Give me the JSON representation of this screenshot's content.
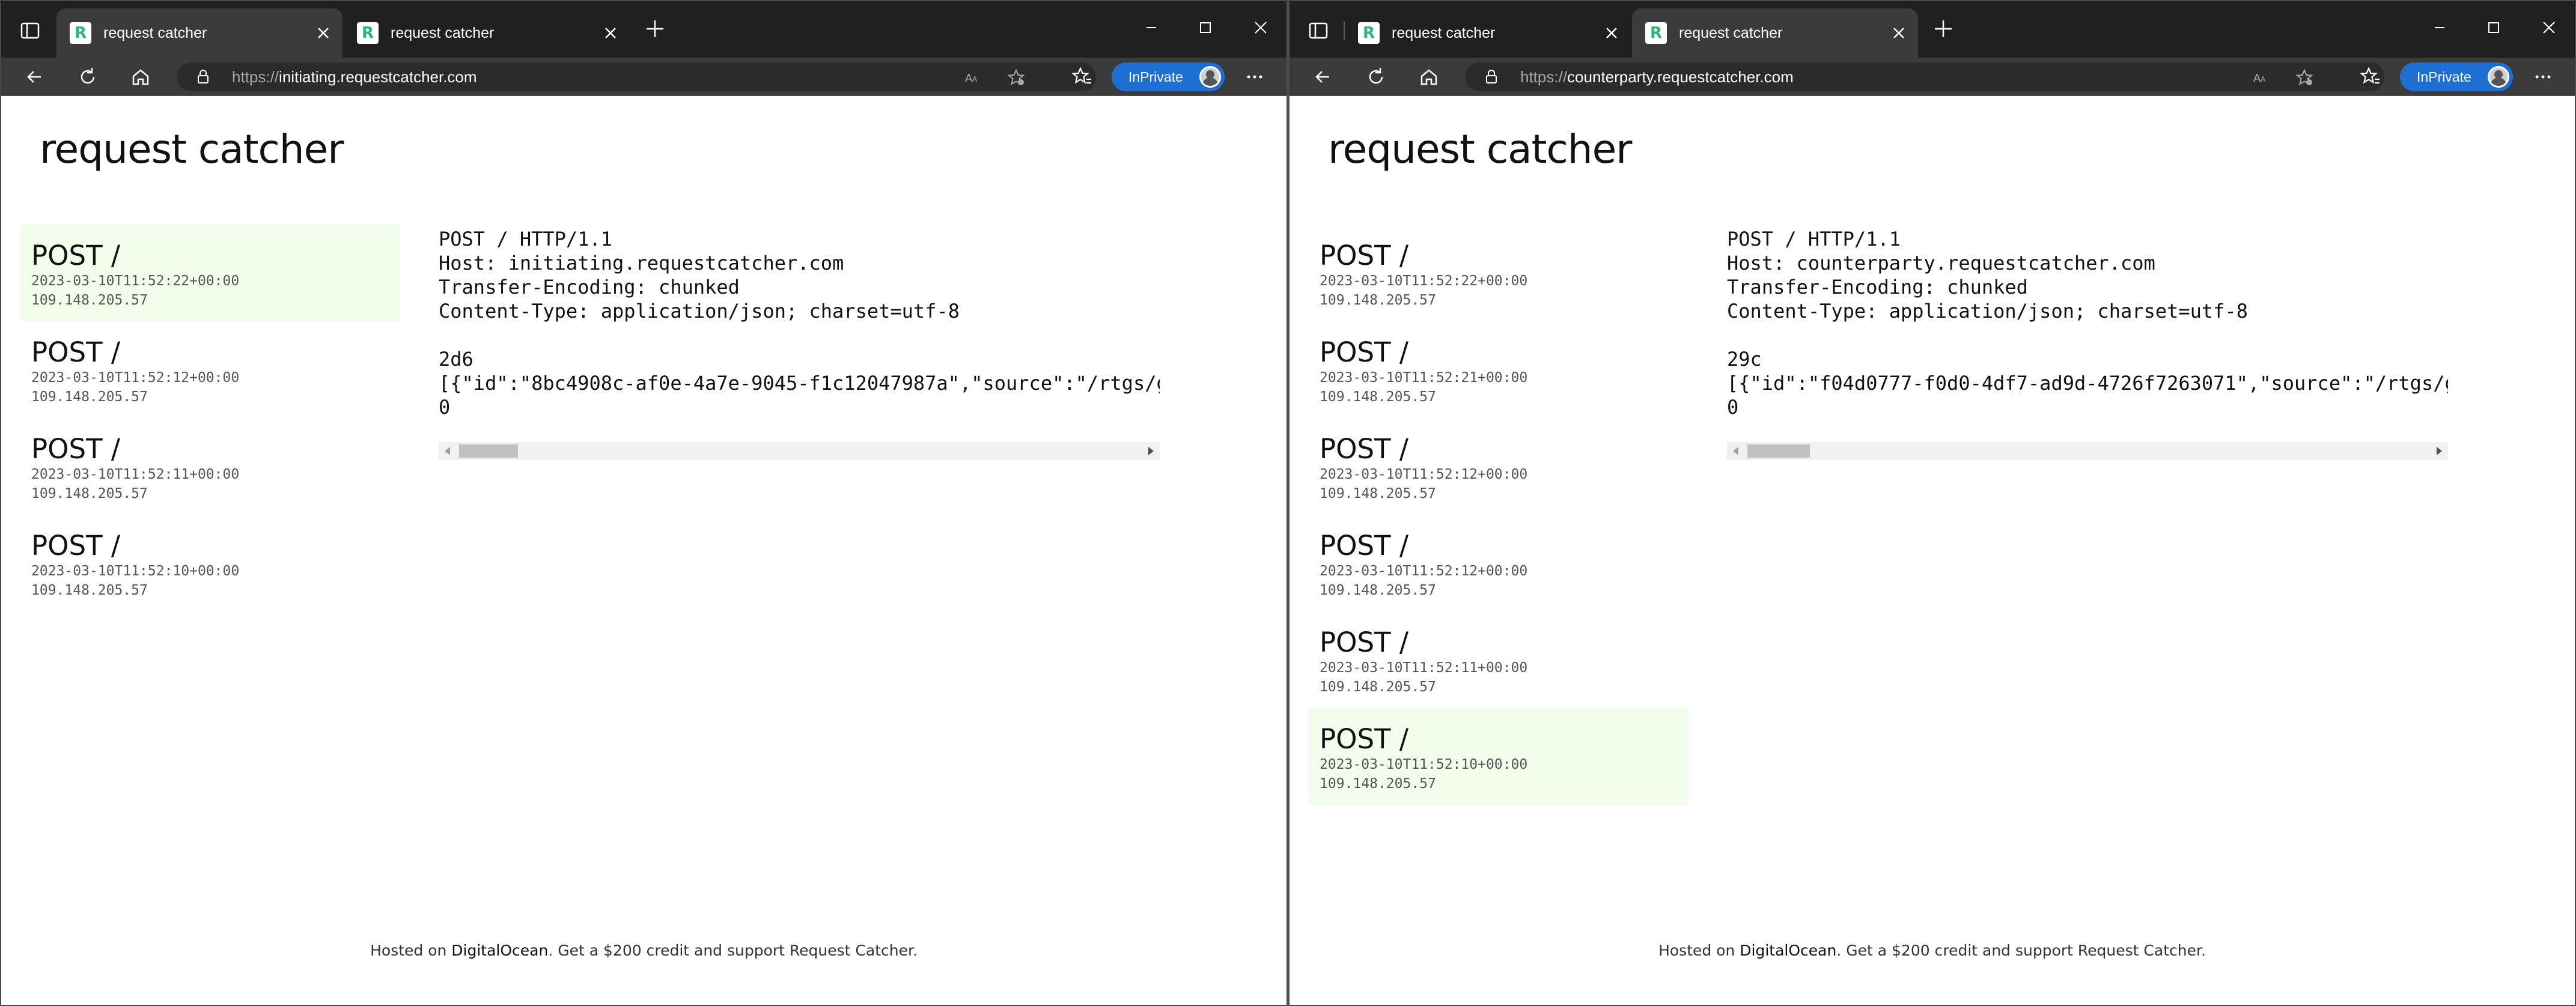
{
  "left_window": {
    "tabs": [
      {
        "favicon": "R",
        "title": "request catcher"
      },
      {
        "favicon": "R",
        "title": "request catcher"
      }
    ],
    "address": {
      "scheme": "https://",
      "host": "initiating.requestcatcher.com"
    },
    "inprivate_label": "InPrivate",
    "page": {
      "title": "request catcher",
      "requests": [
        {
          "method": "POST /",
          "timestamp": "2023-03-10T11:52:22+00:00",
          "ip": "109.148.205.57"
        },
        {
          "method": "POST /",
          "timestamp": "2023-03-10T11:52:12+00:00",
          "ip": "109.148.205.57"
        },
        {
          "method": "POST /",
          "timestamp": "2023-03-10T11:52:11+00:00",
          "ip": "109.148.205.57"
        },
        {
          "method": "POST /",
          "timestamp": "2023-03-10T11:52:10+00:00",
          "ip": "109.148.205.57"
        }
      ],
      "selected_index": 0,
      "detail": {
        "request_line": "POST / HTTP/1.1",
        "host": "Host: initiating.requestcatcher.com",
        "transfer_encoding": "Transfer-Encoding: chunked",
        "content_type": "Content-Type: application/json; charset=utf-8",
        "chunk_size": "2d6",
        "body": "[{\"id\":\"8bc4908c-af0e-4a7e-9045-f1c12047987a\",\"source\":\"/rtgs/g",
        "terminator": "0"
      },
      "footer": {
        "prefix": "Hosted on ",
        "link": "DigitalOcean",
        "suffix": ". Get a $200 credit and support Request Catcher."
      }
    }
  },
  "right_window": {
    "tabs": [
      {
        "favicon": "R",
        "title": "request catcher"
      },
      {
        "favicon": "R",
        "title": "request catcher"
      }
    ],
    "address": {
      "scheme": "https://",
      "host": "counterparty.requestcatcher.com"
    },
    "inprivate_label": "InPrivate",
    "page": {
      "title": "request catcher",
      "requests": [
        {
          "method": "POST /",
          "timestamp": "2023-03-10T11:52:22+00:00",
          "ip": "109.148.205.57"
        },
        {
          "method": "POST /",
          "timestamp": "2023-03-10T11:52:21+00:00",
          "ip": "109.148.205.57"
        },
        {
          "method": "POST /",
          "timestamp": "2023-03-10T11:52:12+00:00",
          "ip": "109.148.205.57"
        },
        {
          "method": "POST /",
          "timestamp": "2023-03-10T11:52:12+00:00",
          "ip": "109.148.205.57"
        },
        {
          "method": "POST /",
          "timestamp": "2023-03-10T11:52:11+00:00",
          "ip": "109.148.205.57"
        },
        {
          "method": "POST /",
          "timestamp": "2023-03-10T11:52:10+00:00",
          "ip": "109.148.205.57"
        }
      ],
      "selected_index": 5,
      "detail": {
        "request_line": "POST / HTTP/1.1",
        "host": "Host: counterparty.requestcatcher.com",
        "transfer_encoding": "Transfer-Encoding: chunked",
        "content_type": "Content-Type: application/json; charset=utf-8",
        "chunk_size": "29c",
        "body": "[{\"id\":\"f04d0777-f0d0-4df7-ad9d-4726f7263071\",\"source\":\"/rtgs/g",
        "terminator": "0"
      },
      "footer": {
        "prefix": "Hosted on ",
        "link": "DigitalOcean",
        "suffix": ". Get a $200 credit and support Request Catcher."
      }
    }
  },
  "colors": {
    "accent_blue": "#1d6fd2",
    "selected_row": "#f3fdec",
    "chrome_dark": "#202020",
    "toolbar": "#3b3b3b"
  },
  "icons": [
    "tab-actions-icon",
    "favicon-r-icon",
    "close-icon",
    "plus-icon",
    "minimize-icon",
    "maximize-icon",
    "back-arrow-icon",
    "refresh-icon",
    "home-icon",
    "lock-icon",
    "read-aloud-icon",
    "add-favorite-icon",
    "favorites-icon",
    "profile-avatar-icon",
    "more-icon"
  ]
}
